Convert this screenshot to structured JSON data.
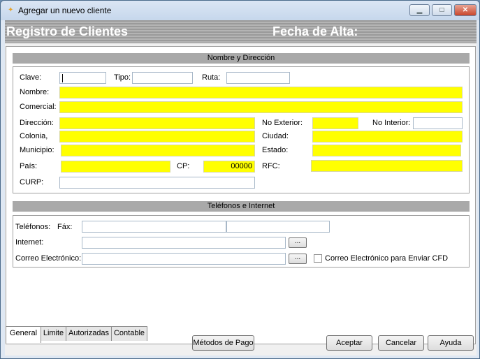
{
  "window": {
    "title": "Agregar un nuevo cliente",
    "minimize_glyph": "▁",
    "maximize_glyph": "□",
    "close_glyph": "✕"
  },
  "header": {
    "title": "Registro de Clientes",
    "date_label": "Fecha de Alta:"
  },
  "sections": {
    "address": {
      "title": "Nombre y Dirección",
      "clave_label": "Clave:",
      "clave_value": "",
      "tipo_label": "Tipo:",
      "tipo_value": "",
      "ruta_label": "Ruta:",
      "ruta_value": "",
      "nombre_label": "Nombre:",
      "nombre_value": "",
      "comercial_label": "Comercial:",
      "comercial_value": "",
      "direccion_label": "Dirección:",
      "direccion_value": "",
      "no_exterior_label": "No Exterior:",
      "no_exterior_value": "",
      "no_interior_label": "No Interior:",
      "no_interior_value": "",
      "colonia_label": "Colonia,",
      "colonia_value": "",
      "ciudad_label": "Ciudad:",
      "ciudad_value": "",
      "municipio_label": "Municipio:",
      "municipio_value": "",
      "estado_label": "Estado:",
      "estado_value": "",
      "pais_label": "País:",
      "pais_value": "",
      "cp_label": "CP:",
      "cp_value": "00000",
      "rfc_label": "RFC:",
      "rfc_value": "",
      "curp_label": "CURP:",
      "curp_value": ""
    },
    "contact": {
      "title": "Teléfonos e Internet",
      "telefonos_label": "Teléfonos:",
      "fax_label": "Fáx:",
      "telefonos_value": "",
      "fax_value": "",
      "internet_label": "Internet:",
      "internet_value": "",
      "correo_label": "Correo Electrónico:",
      "correo_value": "",
      "browse_label": "...",
      "cfd_checkbox_label": "Correo Electrónico para Enviar CFD",
      "cfd_checked": false
    }
  },
  "tabs": [
    {
      "label": "General",
      "active": true
    },
    {
      "label": "Limite",
      "active": false
    },
    {
      "label": "Autorizadas",
      "active": false
    },
    {
      "label": "Contable",
      "active": false
    }
  ],
  "buttons": {
    "metodos_pago": "Métodos de Pago",
    "aceptar": "Aceptar",
    "cancelar": "Cancelar",
    "ayuda": "Ayuda"
  },
  "colors": {
    "required_field": "#ffff00",
    "section_bar": "#a9a9a9"
  }
}
